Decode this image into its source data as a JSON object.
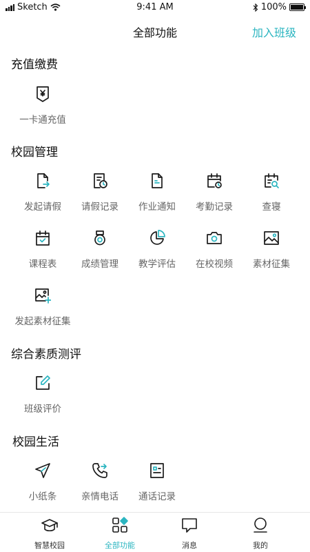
{
  "status": {
    "carrier": "Sketch",
    "time": "9:41 AM",
    "battery": "100%"
  },
  "nav": {
    "title": "全部功能",
    "action": "加入班级"
  },
  "sections": [
    {
      "title": "充值缴费",
      "items": [
        {
          "label": "一卡通充值",
          "icon": "card-recharge-icon"
        }
      ]
    },
    {
      "title": "校园管理",
      "items": [
        {
          "label": "发起请假",
          "icon": "leave-request-icon"
        },
        {
          "label": "请假记录",
          "icon": "leave-record-icon"
        },
        {
          "label": "作业通知",
          "icon": "homework-icon"
        },
        {
          "label": "考勤记录",
          "icon": "attendance-icon"
        },
        {
          "label": "查寝",
          "icon": "dorm-check-icon"
        },
        {
          "label": "课程表",
          "icon": "schedule-icon"
        },
        {
          "label": "成绩管理",
          "icon": "grades-icon"
        },
        {
          "label": "教学评估",
          "icon": "evaluation-pie-icon"
        },
        {
          "label": "在校视频",
          "icon": "camera-icon"
        },
        {
          "label": "素材征集",
          "icon": "image-icon"
        },
        {
          "label": "发起素材征集",
          "icon": "add-image-icon"
        }
      ]
    },
    {
      "title": "综合素质测评",
      "items": [
        {
          "label": "班级评价",
          "icon": "edit-icon"
        }
      ]
    },
    {
      "title": "校园生活",
      "items": [
        {
          "label": "小纸条",
          "icon": "send-icon"
        },
        {
          "label": "亲情电话",
          "icon": "phone-forward-icon"
        },
        {
          "label": "通话记录",
          "icon": "call-log-icon"
        }
      ]
    }
  ],
  "tabs": [
    {
      "label": "智慧校园",
      "icon": "graduation-cap-icon",
      "active": false
    },
    {
      "label": "全部功能",
      "icon": "apps-icon",
      "active": true
    },
    {
      "label": "消息",
      "icon": "message-icon",
      "active": false
    },
    {
      "label": "我的",
      "icon": "profile-icon",
      "active": false
    }
  ],
  "colors": {
    "accent": "#2bb5c0",
    "icon_dark": "#1a1a1a",
    "label_gray": "#666666"
  }
}
